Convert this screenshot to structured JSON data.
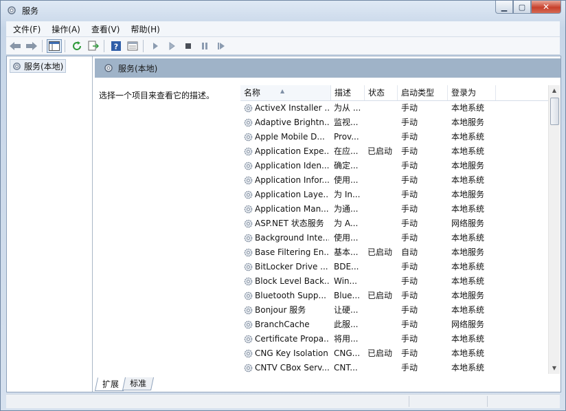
{
  "window": {
    "title": "服务"
  },
  "menu": [
    "文件(F)",
    "操作(A)",
    "查看(V)",
    "帮助(H)"
  ],
  "tree": {
    "root": "服务(本地)"
  },
  "pane": {
    "title": "服务(本地)",
    "description": "选择一个项目来查看它的描述。"
  },
  "columns": {
    "name": "名称",
    "desc": "描述",
    "status": "状态",
    "startup": "启动类型",
    "logon": "登录为"
  },
  "services": [
    {
      "name": "ActiveX Installer ...",
      "desc": "为从 ...",
      "status": "",
      "startup": "手动",
      "logon": "本地系统"
    },
    {
      "name": "Adaptive Brightn...",
      "desc": "监视...",
      "status": "",
      "startup": "手动",
      "logon": "本地服务"
    },
    {
      "name": "Apple Mobile D...",
      "desc": "Prov...",
      "status": "",
      "startup": "手动",
      "logon": "本地系统"
    },
    {
      "name": "Application Expe...",
      "desc": "在应...",
      "status": "已启动",
      "startup": "手动",
      "logon": "本地系统"
    },
    {
      "name": "Application Iden...",
      "desc": "确定...",
      "status": "",
      "startup": "手动",
      "logon": "本地服务"
    },
    {
      "name": "Application Infor...",
      "desc": "使用...",
      "status": "",
      "startup": "手动",
      "logon": "本地系统"
    },
    {
      "name": "Application Laye...",
      "desc": "为 In...",
      "status": "",
      "startup": "手动",
      "logon": "本地服务"
    },
    {
      "name": "Application Man...",
      "desc": "为通...",
      "status": "",
      "startup": "手动",
      "logon": "本地系统"
    },
    {
      "name": "ASP.NET 状态服务",
      "desc": "为 A...",
      "status": "",
      "startup": "手动",
      "logon": "网络服务"
    },
    {
      "name": "Background Inte...",
      "desc": "使用...",
      "status": "",
      "startup": "手动",
      "logon": "本地系统"
    },
    {
      "name": "Base Filtering En...",
      "desc": "基本...",
      "status": "已启动",
      "startup": "自动",
      "logon": "本地服务"
    },
    {
      "name": "BitLocker Drive ...",
      "desc": "BDE...",
      "status": "",
      "startup": "手动",
      "logon": "本地系统"
    },
    {
      "name": "Block Level Back...",
      "desc": "Win...",
      "status": "",
      "startup": "手动",
      "logon": "本地系统"
    },
    {
      "name": "Bluetooth Supp...",
      "desc": "Blue...",
      "status": "已启动",
      "startup": "手动",
      "logon": "本地服务"
    },
    {
      "name": "Bonjour 服务",
      "desc": "让硬...",
      "status": "",
      "startup": "手动",
      "logon": "本地系统"
    },
    {
      "name": "BranchCache",
      "desc": "此服...",
      "status": "",
      "startup": "手动",
      "logon": "网络服务"
    },
    {
      "name": "Certificate Propa...",
      "desc": "将用...",
      "status": "",
      "startup": "手动",
      "logon": "本地系统"
    },
    {
      "name": "CNG Key Isolation",
      "desc": "CNG...",
      "status": "已启动",
      "startup": "手动",
      "logon": "本地系统"
    },
    {
      "name": "CNTV CBox Serv...",
      "desc": "CNT...",
      "status": "",
      "startup": "手动",
      "logon": "本地系统"
    }
  ],
  "tabs": [
    "扩展",
    "标准"
  ]
}
